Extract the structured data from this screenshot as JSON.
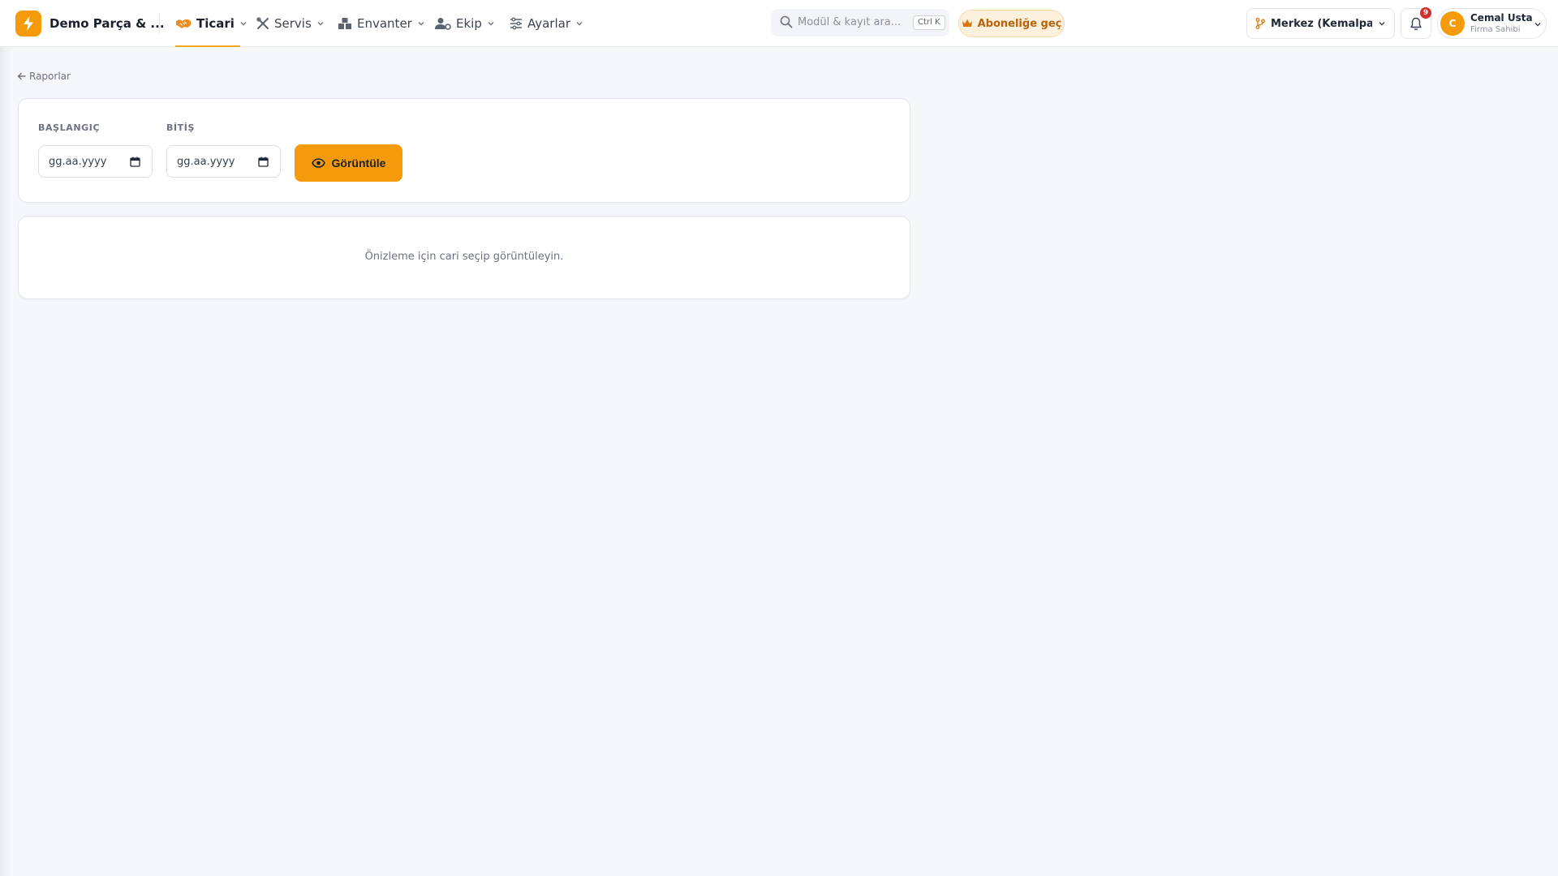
{
  "app": {
    "brand": "Demo Parça & ...",
    "accent_color": "#f59b0b"
  },
  "nav": [
    {
      "label": "Ticari",
      "icon": "handshake-icon",
      "active": true
    },
    {
      "label": "Servis",
      "icon": "tools-icon",
      "active": false
    },
    {
      "label": "Envanter",
      "icon": "boxes-icon",
      "active": false
    },
    {
      "label": "Ekip",
      "icon": "users-gear-icon",
      "active": false
    },
    {
      "label": "Ayarlar",
      "icon": "sliders-icon",
      "active": false
    }
  ],
  "search": {
    "placeholder": "Modül & kayıt ara...",
    "shortcut": "Ctrl K"
  },
  "subscribe_label": "Aboneliğe geç",
  "branch_label": "Merkez (Kemalpa...",
  "notifications": {
    "count": "9"
  },
  "user": {
    "initial": "C",
    "name": "Cemal Usta",
    "role": "Firma Sahibi"
  },
  "breadcrumb": {
    "back_label": "Raporlar"
  },
  "filters": {
    "start_label": "BAŞLANGIÇ",
    "start_value": "gg.aa.yyyy",
    "end_label": "BİTİŞ",
    "end_value": "gg.aa.yyyy",
    "view_button": "Görüntüle"
  },
  "preview": {
    "empty_message": "Önizleme için cari seçip görüntüleyin."
  }
}
